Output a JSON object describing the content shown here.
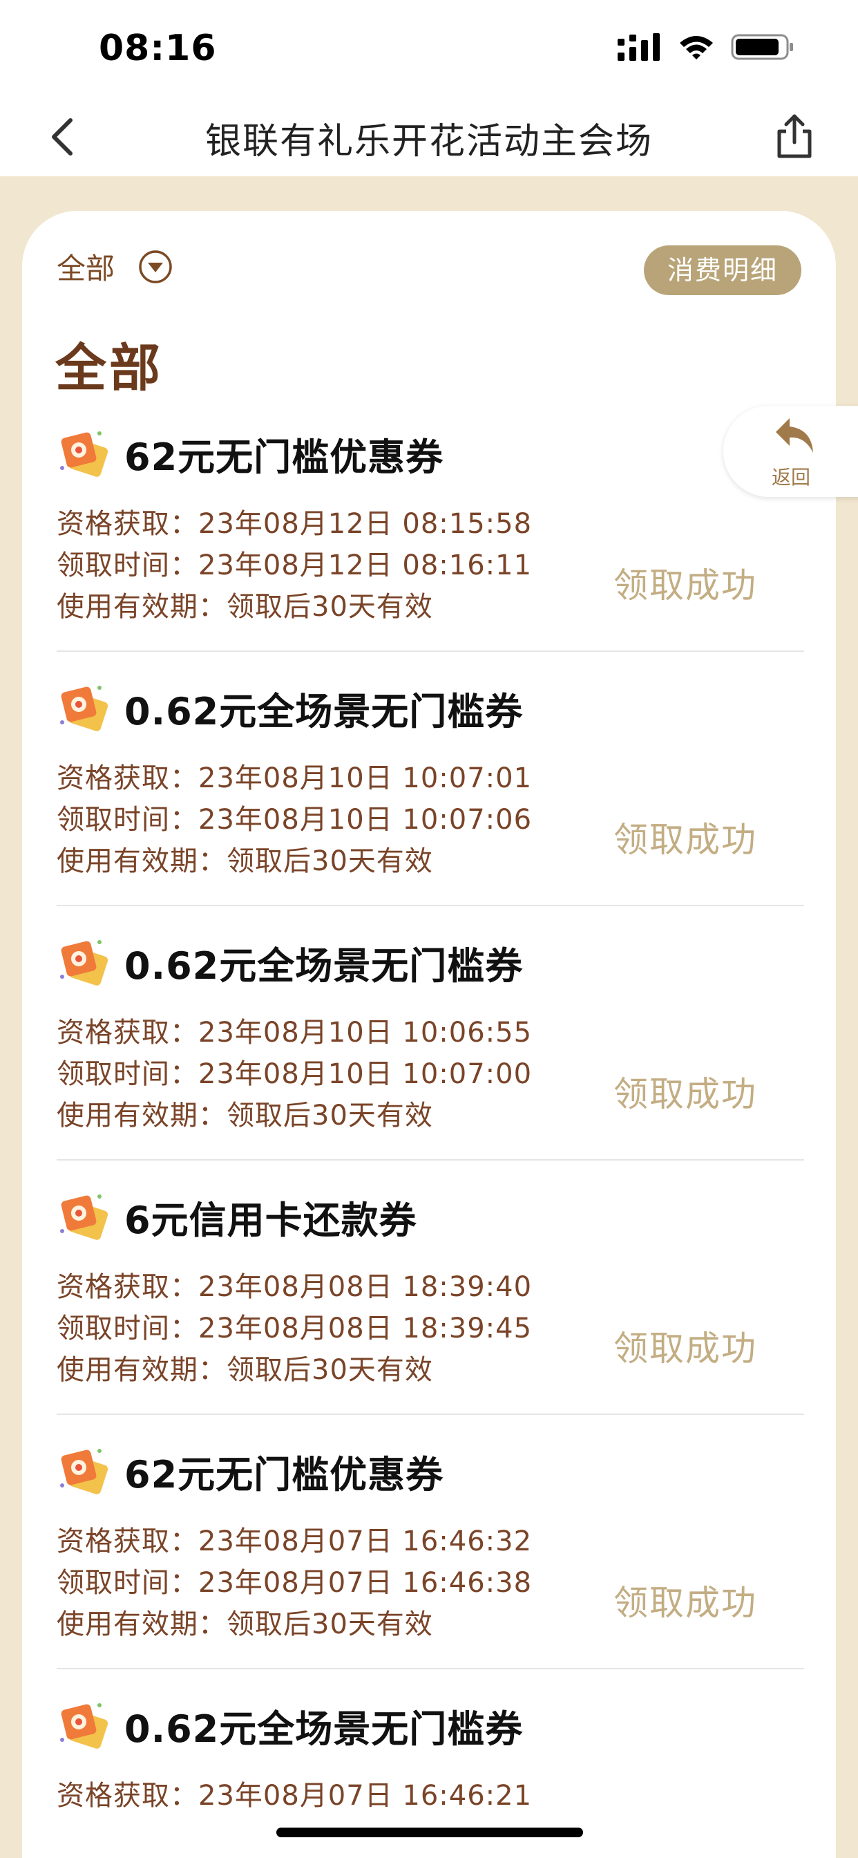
{
  "status_bar": {
    "time": "08:16"
  },
  "nav": {
    "title": "银联有礼乐开花活动主会场"
  },
  "filter": {
    "label": "全部",
    "detail_button": "消费明细"
  },
  "section_title": "全部",
  "float_return": {
    "label": "返回"
  },
  "coupons": [
    {
      "title": "62元无门槛优惠券",
      "qualify": "资格获取：23年08月12日 08:15:58",
      "receive": "领取时间：23年08月12日 08:16:11",
      "validity": "使用有效期：领取后30天有效",
      "status": "领取成功"
    },
    {
      "title": "0.62元全场景无门槛券",
      "qualify": "资格获取：23年08月10日 10:07:01",
      "receive": "领取时间：23年08月10日 10:07:06",
      "validity": "使用有效期：领取后30天有效",
      "status": "领取成功"
    },
    {
      "title": "0.62元全场景无门槛券",
      "qualify": "资格获取：23年08月10日 10:06:55",
      "receive": "领取时间：23年08月10日 10:07:00",
      "validity": "使用有效期：领取后30天有效",
      "status": "领取成功"
    },
    {
      "title": "6元信用卡还款券",
      "qualify": "资格获取：23年08月08日 18:39:40",
      "receive": "领取时间：23年08月08日 18:39:45",
      "validity": "使用有效期：领取后30天有效",
      "status": "领取成功"
    },
    {
      "title": "62元无门槛优惠券",
      "qualify": "资格获取：23年08月07日 16:46:32",
      "receive": "领取时间：23年08月07日 16:46:38",
      "validity": "使用有效期：领取后30天有效",
      "status": "领取成功"
    },
    {
      "title": "0.62元全场景无门槛券",
      "qualify": "资格获取：23年08月07日 16:46:21"
    }
  ],
  "colors": {
    "page_bg": "#f1e6cf",
    "accent_brown": "#6b3a1c",
    "detail_text": "#7a4428",
    "status_gold": "#c3ad83",
    "button_gold": "#b8a478"
  },
  "icons": {
    "back": "chevron-left-icon",
    "share": "share-icon",
    "filter": "dropdown-circle-icon",
    "coupon": "coupon-icon",
    "return": "return-arrow-icon"
  }
}
